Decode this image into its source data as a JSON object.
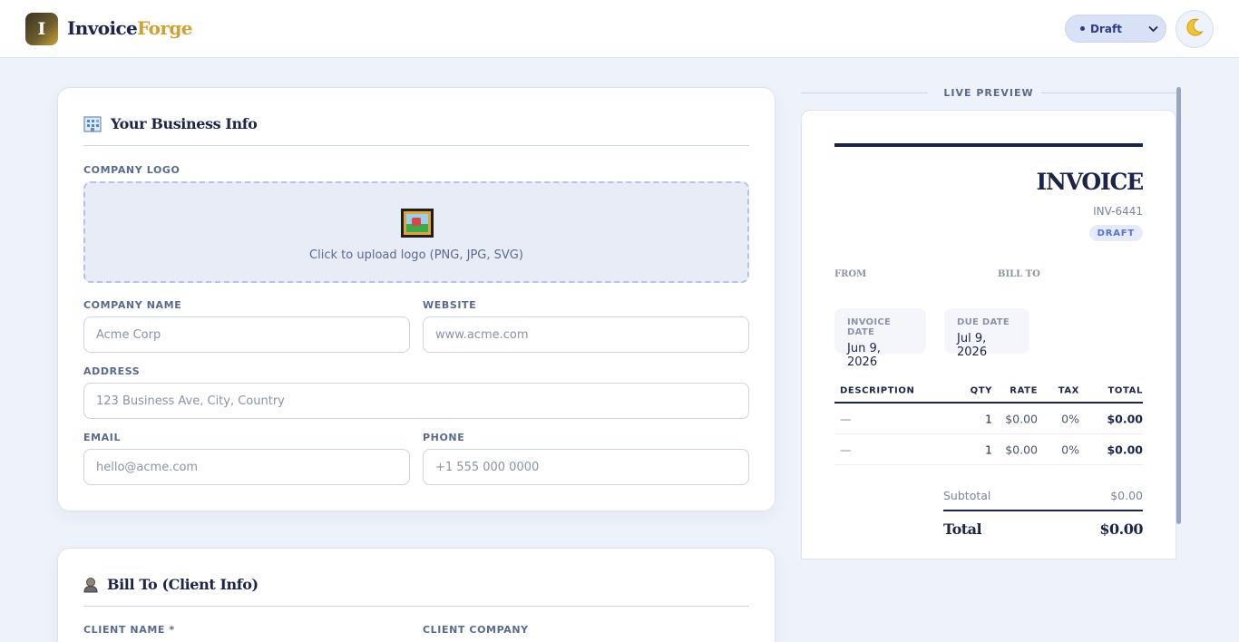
{
  "header": {
    "brand_part1": "Invoice",
    "brand_part2": "Forge",
    "logo_letter": "I",
    "status_select": {
      "selected": "Draft"
    },
    "theme_toggle_icon": "moon-icon"
  },
  "business": {
    "title": "Your Business Info",
    "icon": "building-icon",
    "logo": {
      "label": "COMPANY LOGO",
      "upload_text": "Click to upload logo (PNG, JPG, SVG)",
      "icon": "framed-picture-icon"
    },
    "company_name": {
      "label": "COMPANY NAME",
      "placeholder": "Acme Corp"
    },
    "website": {
      "label": "WEBSITE",
      "placeholder": "www.acme.com"
    },
    "address": {
      "label": "ADDRESS",
      "placeholder": "123 Business Ave, City, Country"
    },
    "email": {
      "label": "EMAIL",
      "placeholder": "hello@acme.com"
    },
    "phone": {
      "label": "PHONE",
      "placeholder": "+1 555 000 0000"
    }
  },
  "client": {
    "title": "Bill To (Client Info)",
    "icon": "person-icon",
    "client_name_label": "CLIENT NAME *",
    "client_company_label": "CLIENT COMPANY"
  },
  "preview": {
    "heading": "LIVE PREVIEW",
    "title": "INVOICE",
    "number": "INV-6441",
    "badge": "DRAFT",
    "from_label": "FROM",
    "billto_label": "BILL TO",
    "invoice_date_label": "INVOICE DATE",
    "invoice_date": "Jun 9, 2026",
    "due_date_label": "DUE DATE",
    "due_date": "Jul 9, 2026",
    "columns": [
      "DESCRIPTION",
      "QTY",
      "RATE",
      "TAX",
      "TOTAL"
    ],
    "rows": [
      {
        "description": "—",
        "qty": "1",
        "rate": "$0.00",
        "tax": "0%",
        "total": "$0.00"
      },
      {
        "description": "—",
        "qty": "1",
        "rate": "$0.00",
        "tax": "0%",
        "total": "$0.00"
      }
    ],
    "subtotal_label": "Subtotal",
    "subtotal": "$0.00",
    "total_label": "Total",
    "total": "$0.00"
  },
  "colors": {
    "navy": "#1c2447",
    "gold": "#d0a032",
    "page_bg": "#eef2fa",
    "badge_text": "#5a70d6"
  }
}
